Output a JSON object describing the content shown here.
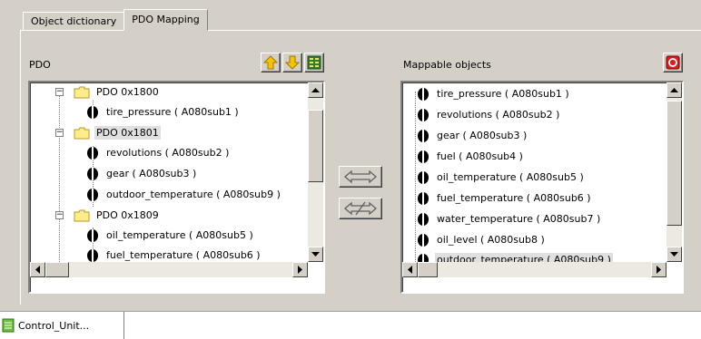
{
  "tabs": [
    {
      "label": "Object dictionary",
      "active": false
    },
    {
      "label": "PDO Mapping",
      "active": true
    }
  ],
  "pdo_panel": {
    "label": "PDO",
    "toolbar": {
      "up_icon": "arrow-up-icon",
      "down_icon": "arrow-down-icon",
      "map_icon": "mapping-table-icon"
    },
    "tree": [
      {
        "type": "group",
        "label": "PDO 0x1800",
        "selected": false
      },
      {
        "type": "object",
        "label": "tire_pressure ( A080sub1 )"
      },
      {
        "type": "group",
        "label": "PDO 0x1801",
        "selected": true
      },
      {
        "type": "object",
        "label": "revolutions ( A080sub2 )"
      },
      {
        "type": "object",
        "label": "gear ( A080sub3 )"
      },
      {
        "type": "object",
        "label": "outdoor_temperature ( A080sub9 )"
      },
      {
        "type": "group",
        "label": "PDO 0x1809",
        "selected": false
      },
      {
        "type": "object",
        "label": "oil_temperature ( A080sub5 )"
      },
      {
        "type": "object",
        "label": "fuel_temperature ( A080sub6 )"
      }
    ]
  },
  "mappable_panel": {
    "label": "Mappable objects",
    "toolbar": {
      "remove_icon": "remove-icon"
    },
    "items": [
      {
        "label": "tire_pressure ( A080sub1 )",
        "selected": false
      },
      {
        "label": "revolutions ( A080sub2 )",
        "selected": false
      },
      {
        "label": "gear ( A080sub3 )",
        "selected": false
      },
      {
        "label": "fuel ( A080sub4 )",
        "selected": false
      },
      {
        "label": "oil_temperature ( A080sub5 )",
        "selected": false
      },
      {
        "label": "fuel_temperature ( A080sub6 )",
        "selected": false
      },
      {
        "label": "water_temperature ( A080sub7 )",
        "selected": false
      },
      {
        "label": "oil_level ( A080sub8 )",
        "selected": false
      },
      {
        "label": "outdoor_temperature ( A080sub9 )",
        "selected": true
      }
    ]
  },
  "center_buttons": {
    "map_icon": "map-arrows-icon",
    "unmap_icon": "unmap-arrows-icon"
  },
  "document_tab": {
    "label": "Control_Unit...",
    "icon": "document-icon"
  }
}
